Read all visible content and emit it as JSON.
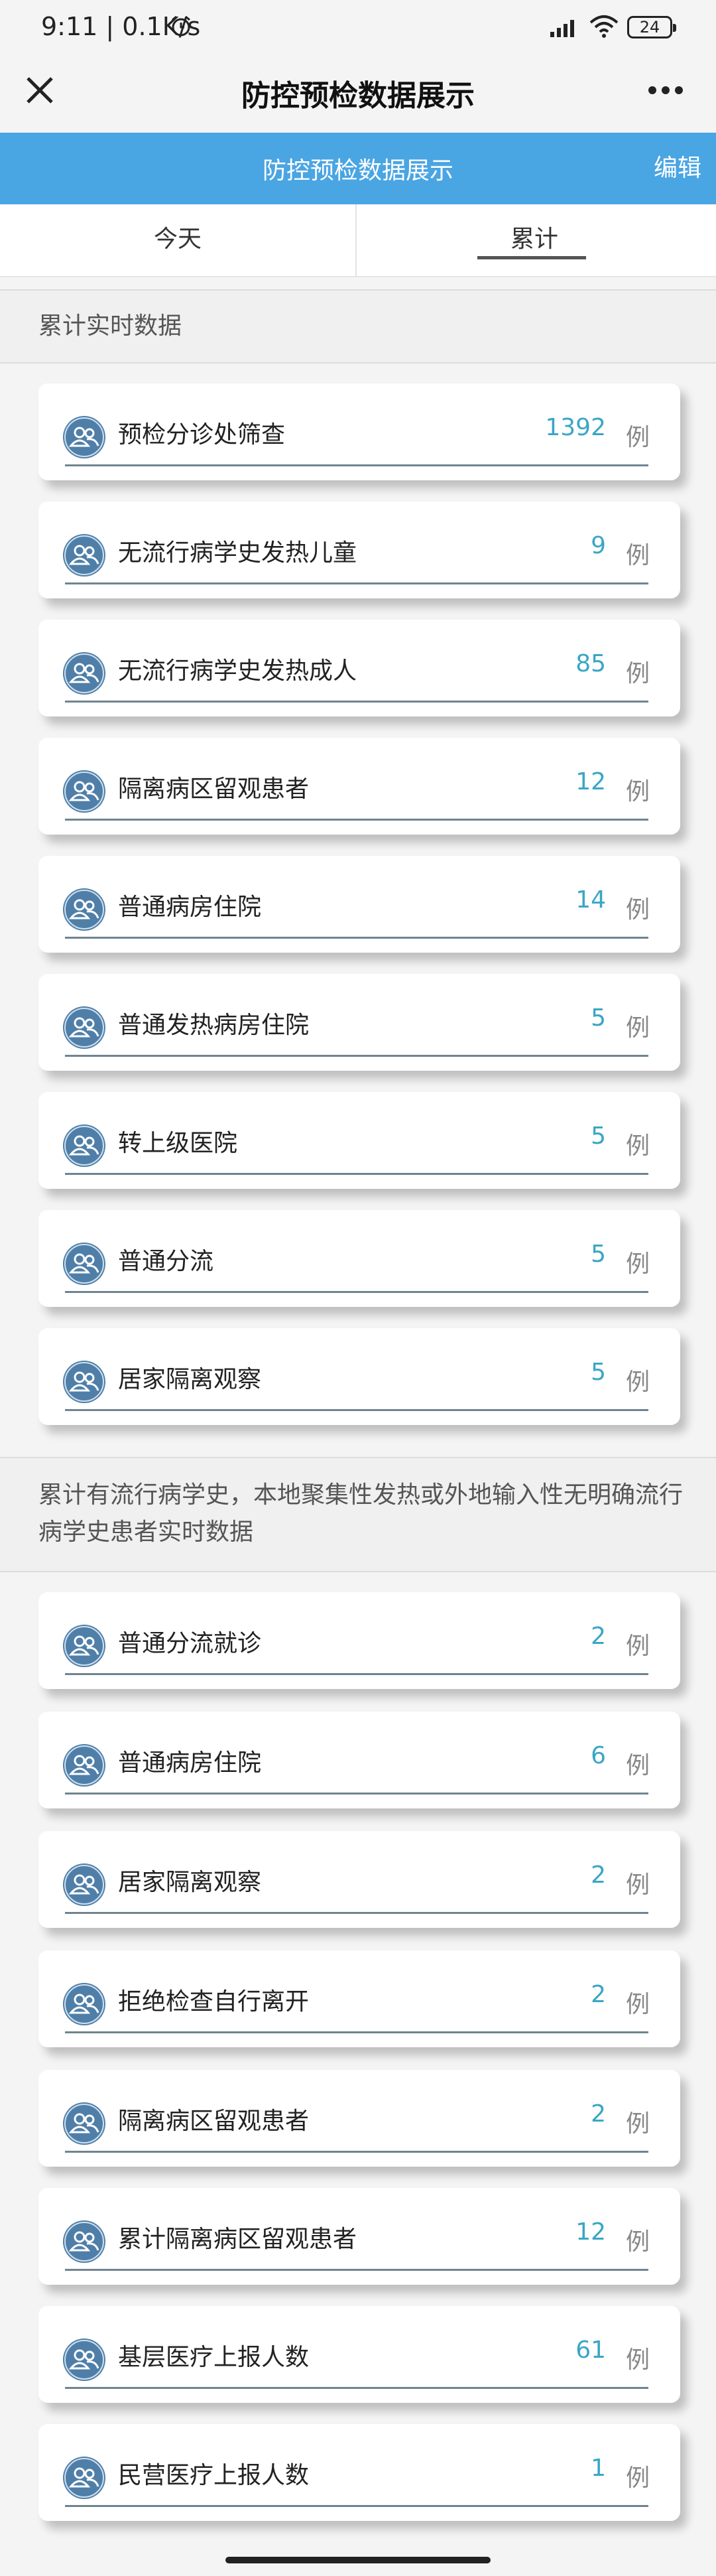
{
  "status_bar": {
    "time": "9:11 | 0.1K/s",
    "battery": "24"
  },
  "title_bar": {
    "title": "防控预检数据展示"
  },
  "blue_bar": {
    "title": "防控预检数据展示",
    "edit_label": "编辑"
  },
  "tabs": [
    {
      "label": "今天"
    },
    {
      "label": "累计"
    }
  ],
  "sections": [
    {
      "title": "累计实时数据",
      "items": [
        {
          "label": "预检分诊处筛查",
          "value": "1392",
          "unit": "例"
        },
        {
          "label": "无流行病学史发热儿童",
          "value": "9",
          "unit": "例"
        },
        {
          "label": "无流行病学史发热成人",
          "value": "85",
          "unit": "例"
        },
        {
          "label": "隔离病区留观患者",
          "value": "12",
          "unit": "例"
        },
        {
          "label": "普通病房住院",
          "value": "14",
          "unit": "例"
        },
        {
          "label": "普通发热病房住院",
          "value": "5",
          "unit": "例"
        },
        {
          "label": "转上级医院",
          "value": "5",
          "unit": "例"
        },
        {
          "label": "普通分流",
          "value": "5",
          "unit": "例"
        },
        {
          "label": "居家隔离观察",
          "value": "5",
          "unit": "例"
        }
      ]
    },
    {
      "title": "累计有流行病学史，本地聚集性发热或外地输入性无明确流行病学史患者实时数据",
      "items": [
        {
          "label": "普通分流就诊",
          "value": "2",
          "unit": "例"
        },
        {
          "label": "普通病房住院",
          "value": "6",
          "unit": "例"
        },
        {
          "label": "居家隔离观察",
          "value": "2",
          "unit": "例"
        },
        {
          "label": "拒绝检查自行离开",
          "value": "2",
          "unit": "例"
        },
        {
          "label": "隔离病区留观患者",
          "value": "2",
          "unit": "例"
        },
        {
          "label": "累计隔离病区留观患者",
          "value": "12",
          "unit": "例"
        },
        {
          "label": "基层医疗上报人数",
          "value": "61",
          "unit": "例"
        },
        {
          "label": "民营医疗上报人数",
          "value": "1",
          "unit": "例"
        }
      ]
    }
  ],
  "colors": {
    "accent": "#4aa5e3",
    "value": "#3aa6c6",
    "icon": "#4f7fa8"
  }
}
